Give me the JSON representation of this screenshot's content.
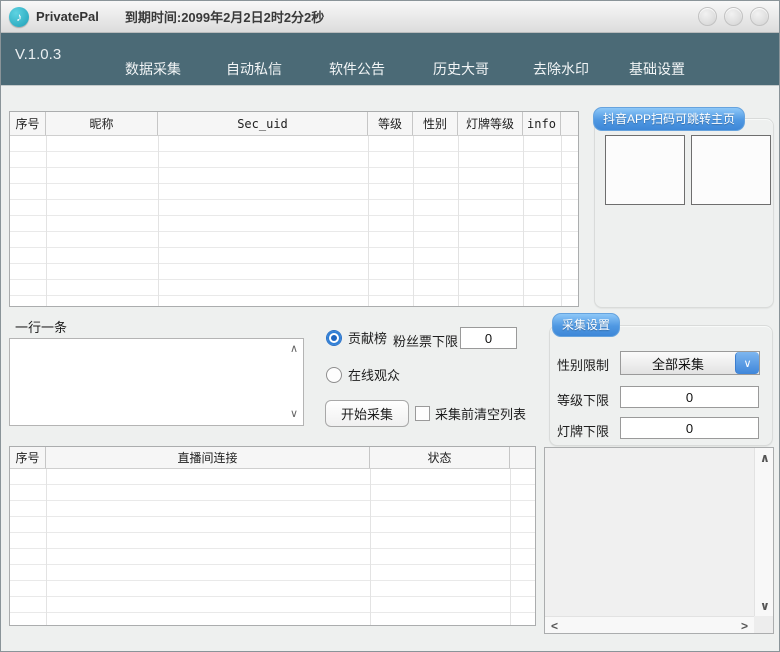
{
  "window": {
    "title": "PrivatePal",
    "expiry": "到期时间:2099年2月2日2时2分2秒"
  },
  "navbar": {
    "version": "V.1.0.3",
    "items": [
      {
        "label": "数据采集"
      },
      {
        "label": "自动私信"
      },
      {
        "label": "软件公告"
      },
      {
        "label": "历史大哥"
      },
      {
        "label": "去除水印"
      },
      {
        "label": "基础设置"
      }
    ]
  },
  "users_table": {
    "headers": [
      "序号",
      "昵称",
      "Sec_uid",
      "等级",
      "性别",
      "灯牌等级",
      "info"
    ],
    "rows": []
  },
  "qr_panel": {
    "badge": "抖音APP扫码可跳转主页"
  },
  "collect_controls": {
    "line_hint": "一行一条",
    "textarea_value": "",
    "contribution_radio": "贡献榜",
    "contribution_checked": true,
    "online_radio": "在线观众",
    "online_checked": false,
    "fan_ticket_label": "粉丝票下限",
    "fan_ticket_value": "0",
    "start_button": "开始采集",
    "clear_before_label": "采集前清空列表",
    "clear_before_checked": false
  },
  "settings": {
    "badge": "采集设置",
    "gender_label": "性别限制",
    "gender_value": "全部采集",
    "level_label": "等级下限",
    "level_value": "0",
    "lamp_label": "灯牌下限",
    "lamp_value": "0"
  },
  "rooms_table": {
    "headers": [
      "序号",
      "直播间连接",
      "状态"
    ],
    "rows": []
  },
  "glyphs": {
    "note": "♪",
    "up": "∧",
    "down": "∨",
    "left": "<",
    "right": ">"
  },
  "colors": {
    "nav_teal": "#4b6a76",
    "badge_blue": "#4a93dd",
    "accent_blue": "#2f7fd6",
    "logo_teal": "#2fb3c6",
    "window_bg": "#eef0ef"
  }
}
